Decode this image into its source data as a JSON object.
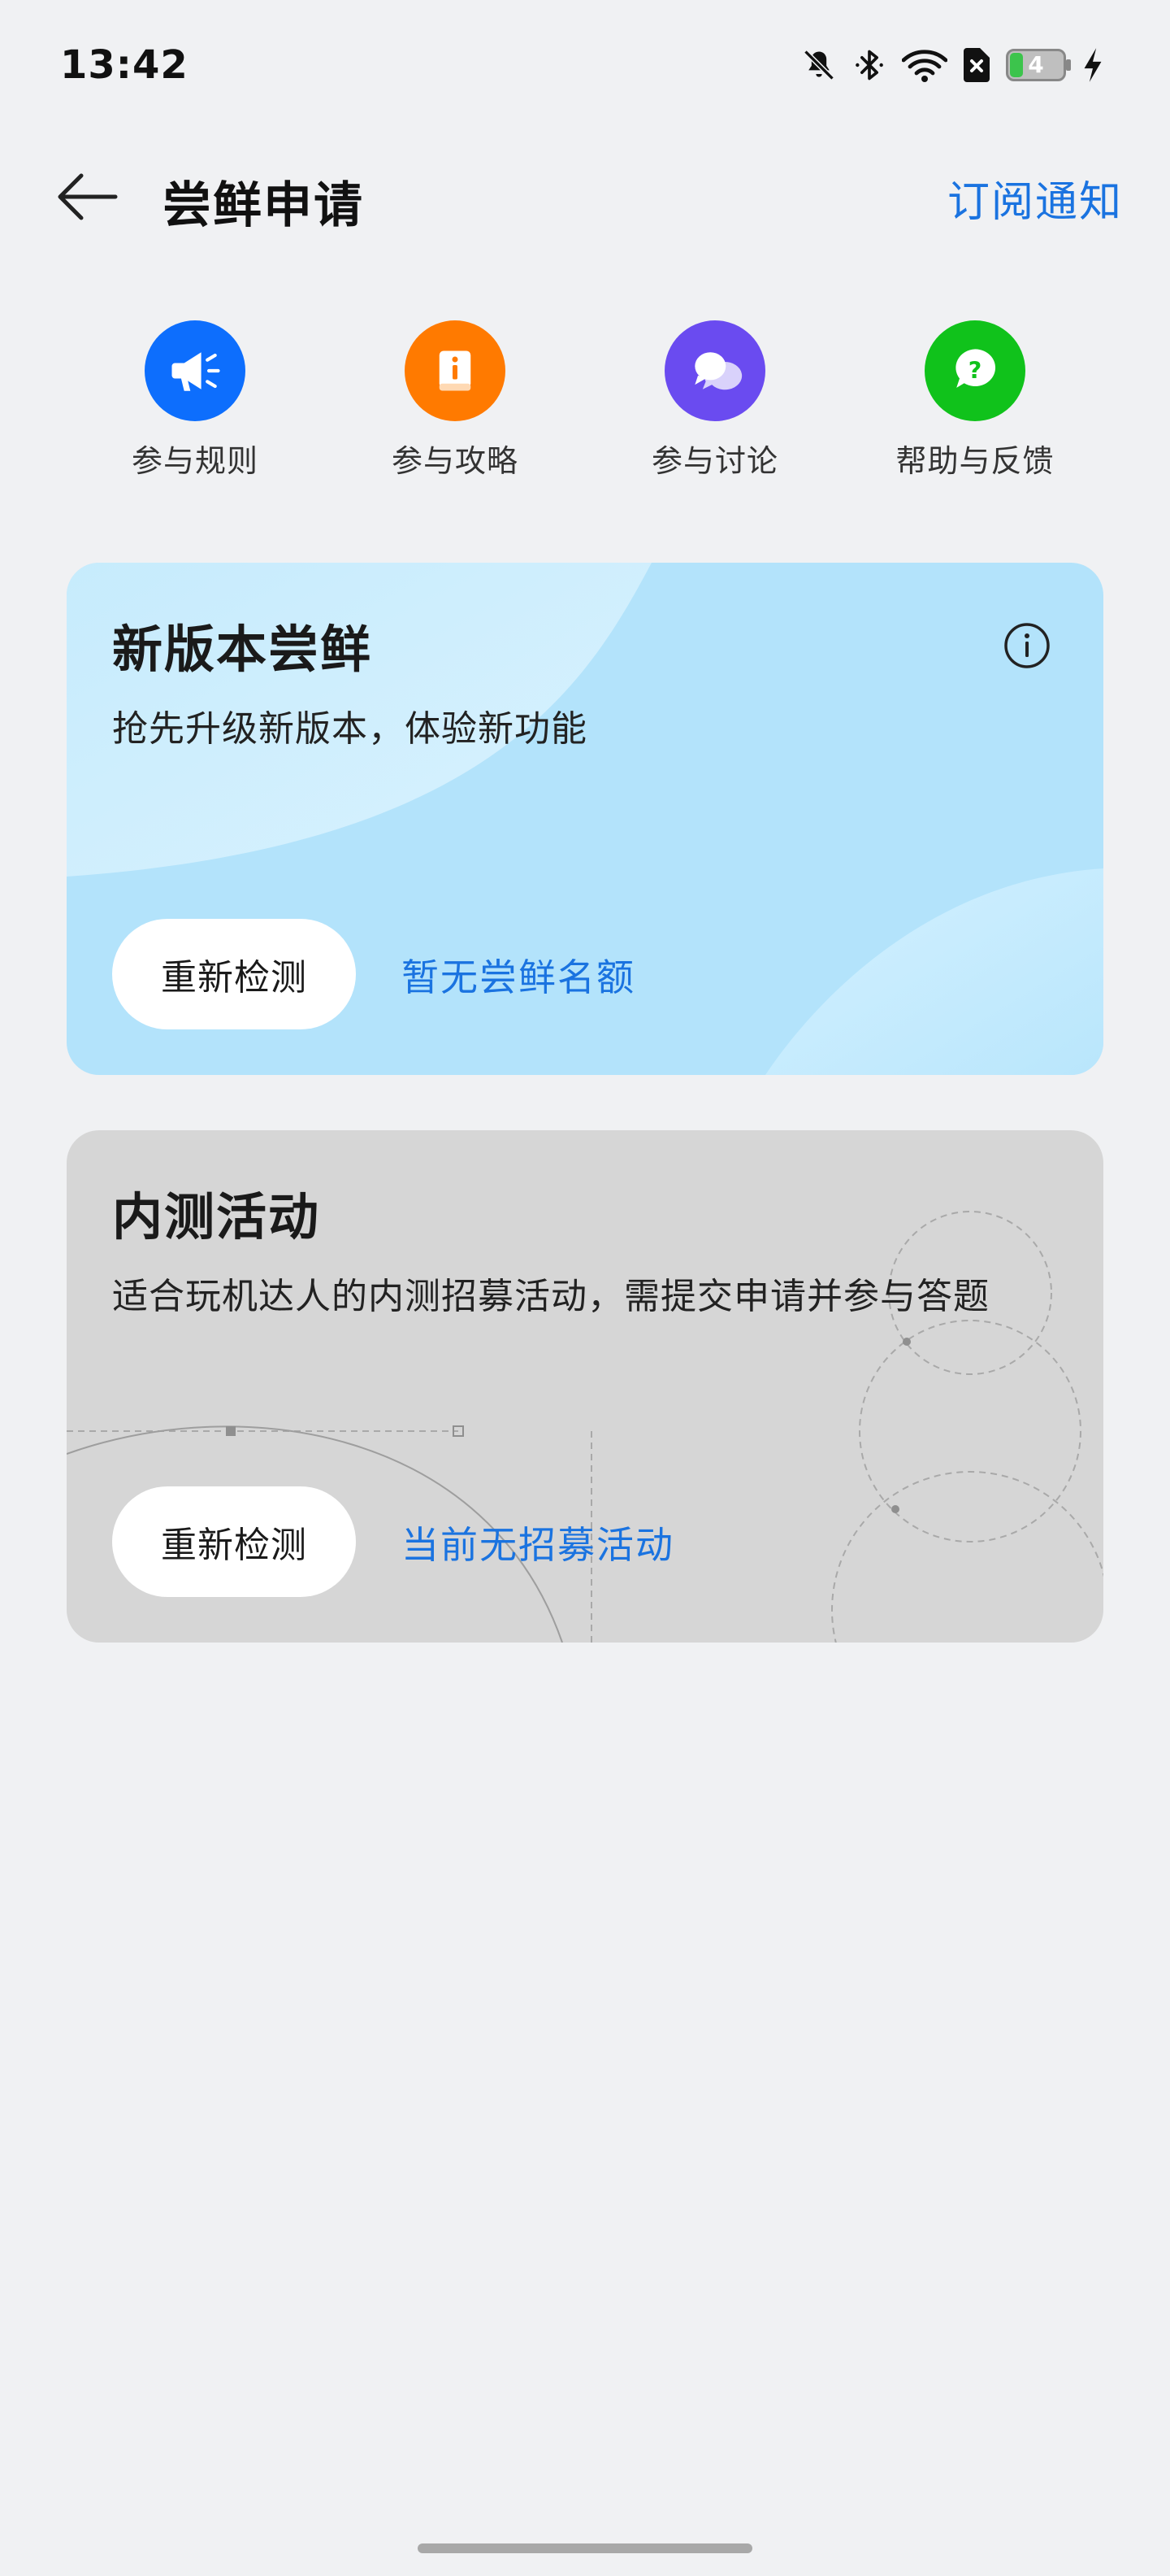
{
  "status_bar": {
    "time": "13:42",
    "battery_level": "4",
    "icons": [
      "bell-muted-icon",
      "bluetooth-icon",
      "wifi-icon",
      "sim-error-icon",
      "battery-icon",
      "charging-icon"
    ]
  },
  "header": {
    "title": "尝鲜申请",
    "subscribe_label": "订阅通知",
    "back_icon": "arrow-left-icon"
  },
  "quick_actions": [
    {
      "label": "参与规则",
      "icon": "megaphone-icon",
      "color": "#0d6efd"
    },
    {
      "label": "参与攻略",
      "icon": "guide-book-icon",
      "color": "#ff7a00"
    },
    {
      "label": "参与讨论",
      "icon": "chat-bubbles-icon",
      "color": "#6a4bf0"
    },
    {
      "label": "帮助与反馈",
      "icon": "help-question-icon",
      "color": "#10c21b"
    }
  ],
  "cards": {
    "trial": {
      "title": "新版本尝鲜",
      "subtitle": "抢先升级新版本，体验新功能",
      "button_label": "重新检测",
      "status": "暂无尝鲜名额",
      "background": "#b3e3fb"
    },
    "beta": {
      "title": "内测活动",
      "subtitle": "适合玩机达人的内测招募活动，需提交申请并参与答题",
      "button_label": "重新检测",
      "status": "当前无招募活动",
      "background": "#d6d6d6"
    }
  },
  "colors": {
    "accent": "#1a73e0",
    "page_background": "#f0f1f3"
  }
}
